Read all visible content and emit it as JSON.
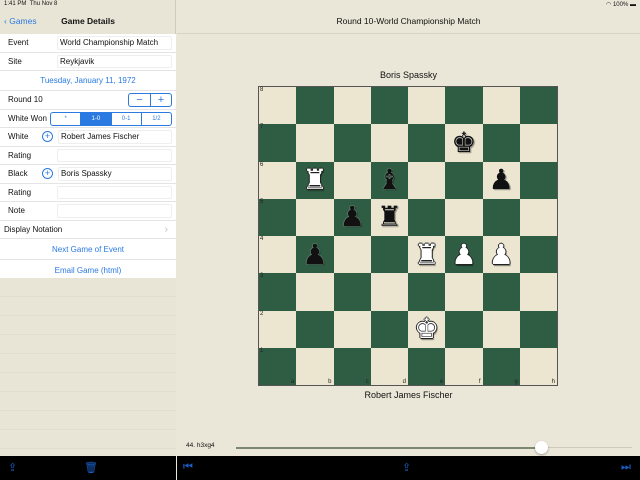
{
  "status": {
    "time": "1:41 PM",
    "date": "Thu Nov 8",
    "battery": "100%"
  },
  "nav": {
    "back": "Games",
    "title": "Game Details"
  },
  "form": {
    "event_label": "Event",
    "event": "World Championship Match",
    "site_label": "Site",
    "site": "Reykjavik",
    "date": "Tuesday, January 11, 1972",
    "round": "Round 10",
    "minus": "−",
    "plus": "+",
    "result_label": "White Won",
    "results": [
      "*",
      "1-0",
      "0-1",
      "1/2"
    ],
    "selected_result": 1,
    "white_label": "White",
    "white": "Robert James Fischer",
    "rating_label": "Rating",
    "white_rating": "",
    "black_label": "Black",
    "black": "Boris Spassky",
    "black_rating": "",
    "note_label": "Note",
    "note": "",
    "display_notation": "Display Notation",
    "chevron": "›",
    "next_game": "Next Game of Event",
    "email": "Email Game (html)"
  },
  "main": {
    "title": "Round 10-World Championship Match",
    "top_player": "Boris Spassky",
    "bottom_player": "Robert James Fischer",
    "move": "44. h3xg4",
    "progress": 0.77
  },
  "board": {
    "files": [
      "a",
      "b",
      "c",
      "d",
      "e",
      "f",
      "g",
      "h"
    ],
    "ranks": [
      "8",
      "7",
      "6",
      "5",
      "4",
      "3",
      "2",
      "1"
    ],
    "pieces": {
      "f7": "bk",
      "b6": "wr",
      "d6": "bb",
      "g6": "bp",
      "c5": "bp",
      "d5": "br",
      "b4": "bp",
      "e4": "wr",
      "f4": "wp",
      "g4": "wp",
      "e2": "wk"
    }
  },
  "colors": {
    "accent": "#2a7ae2",
    "dark_square": "#2f5d43",
    "light_square": "#ece6d0"
  }
}
